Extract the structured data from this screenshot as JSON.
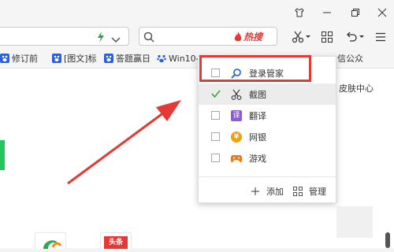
{
  "search": {
    "hot_label": "热搜",
    "placeholder": ""
  },
  "bookmarks": [
    {
      "label": "修订前"
    },
    {
      "label": "[图文]标"
    },
    {
      "label": "答题赢日"
    },
    {
      "label": "Win10-"
    },
    {
      "label": "信公众"
    }
  ],
  "side_panel": {
    "label": "皮肤中心"
  },
  "menu": {
    "items": [
      {
        "label": "登录管家",
        "checked": false,
        "icon": "login-manager-icon"
      },
      {
        "label": "截图",
        "checked": true,
        "icon": "scissors-icon"
      },
      {
        "label": "翻译",
        "checked": false,
        "icon": "translate-icon"
      },
      {
        "label": "网银",
        "checked": false,
        "icon": "online-banking-icon"
      },
      {
        "label": "游戏",
        "checked": false,
        "icon": "game-icon"
      }
    ],
    "translate_glyph": "译",
    "bank_glyph": "¥",
    "add_label": "添加",
    "manage_label": "管理"
  },
  "apps": {
    "app2_glyph": "头条"
  },
  "colors": {
    "accent_red": "#e53935",
    "check_green": "#3aa63a",
    "translate_purple": "#8a5cd6",
    "bank_orange": "#f2a012",
    "game_orange": "#f07a1a"
  }
}
